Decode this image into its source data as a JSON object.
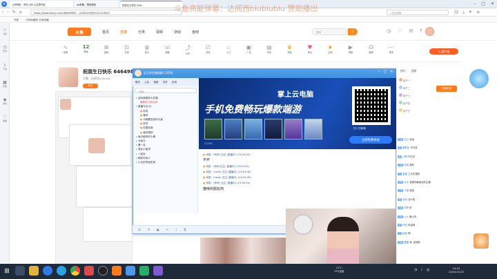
{
  "browser": {
    "tabs": [
      {
        "label": "上网导航 - 有你上网 从这里开始",
        "active": false
      },
      {
        "label": "qq邮箱 - 搜狗搜索",
        "active": false
      },
      {
        "label": "祝我生日快乐 646...",
        "active": true
      }
    ],
    "address": "https://www.douyu.com/6464986?  ...202002/0@2021123022",
    "banner_text": "斗鱼高能弹幕：达闻西biubiubiu 赞助播出",
    "search_placeholder": "在此搜索",
    "bookmarks": [
      "书签",
      "已有收藏夹 已有收藏"
    ],
    "side_tools": [
      "书签",
      "历史",
      "下载",
      "应用",
      "游戏",
      "收藏"
    ]
  },
  "site": {
    "logo": "斗鱼",
    "nav": [
      "首页",
      "直播",
      "分类",
      "视频",
      "游戏",
      "鱼吧"
    ],
    "active_nav": "直播",
    "search_placeholder": "搜索",
    "toolbar": [
      {
        "label": "音量",
        "icon": "wave-icon"
      },
      {
        "label": "等级",
        "value": "12"
      },
      {
        "label": "福利",
        "icon": "gift-icon"
      },
      {
        "label": "礼物",
        "icon": "gift-icon"
      },
      {
        "label": "鱼丸",
        "icon": "fish-icon"
      },
      {
        "label": "弹幕",
        "icon": "chat-icon"
      },
      {
        "label": "分享",
        "icon": "share-icon"
      },
      {
        "label": "任务",
        "icon": "task-icon"
      },
      {
        "label": "火力",
        "icon": "fire-icon"
      },
      {
        "label": "广告",
        "icon": "ad-icon"
      },
      {
        "label": "背包",
        "icon": "bag-icon"
      },
      {
        "label": "贵族",
        "icon": "crown-icon"
      },
      {
        "label": "粉丝",
        "icon": "heart-icon"
      },
      {
        "label": "活动",
        "icon": "star-icon"
      },
      {
        "label": "视频",
        "icon": "video-icon"
      },
      {
        "label": "客服",
        "icon": "service-icon"
      },
      {
        "label": "更多",
        "icon": "more-icon"
      }
    ],
    "pc_client": "PC客户端"
  },
  "room": {
    "title": "祝我生日快乐 6464986",
    "subtitle": "主播：达闻西biubiubiu",
    "follow": "关注"
  },
  "qq": {
    "title": "云大学生服务群 (1456)",
    "tabs": [
      "聊天",
      "公告",
      "相册",
      "文件",
      "应用"
    ],
    "search_placeholder": "搜索",
    "groups": [
      "会有美丽的大花猫",
      "最新的人别出声",
      "直播今天(4)",
      "你说",
      "雪你",
      "今晚要变成你大鱼",
      "好好",
      "你喜欢我",
      "我好想的",
      "每天都有好心情",
      "大秋天",
      "第一名",
      "美女小姐来",
      "一起玩",
      "精彩时间人",
      "小白的早起发现"
    ],
    "ad": {
      "line1": "掌上云电脑",
      "line2": "手机免费畅玩爆款端游",
      "btn": "立即免费体验",
      "qr": "扫一扫体验",
      "tag": "CLOUD"
    },
    "messages": [
      "消息：(有吗) 达达 (直播中) (19:04:44)",
      "不开",
      "消息：(有吗)达达 (直播中) (19:04:45)",
      "消息：(hello) 达达 (直播中) (19:04:46)",
      "消息：(hello) 达达 (直播中) (19:04:49)",
      "消息：(有吗) 达达 (直播中) (19:04:54)",
      "猫咪的朋友阿"
    ],
    "send": "发送",
    "close": "关闭"
  },
  "chat_panel": {
    "tabs": [
      "排行",
      "贡献"
    ],
    "vip": "开通贵族",
    "rank": [
      "用户一",
      "用户二",
      "用户三",
      "用户四",
      "用户五"
    ],
    "items": [
      {
        "name": "红心",
        "msg": "加油"
      },
      {
        "name": "跟着走",
        "msg": "不打扰"
      },
      {
        "name": "刀锋",
        "msg": "不打字"
      },
      {
        "name": "哈哈",
        "msg": "很好"
      },
      {
        "name": "星星",
        "msg": "三大天领呢"
      },
      {
        "name": "大大",
        "msg": "我是你最喜欢的主播"
      },
      {
        "name": "小猫",
        "msg": "哈哈"
      },
      {
        "name": "呆呆",
        "msg": "怎么啦"
      },
      {
        "name": "好吧",
        "msg": "好"
      },
      {
        "name": "火火",
        "msg": "晚上好"
      },
      {
        "name": "吃吃",
        "msg": "说话呀"
      },
      {
        "name": "饭饭",
        "msg": "啊"
      },
      {
        "name": "酷酷",
        "msg": "我, 真想你"
      }
    ]
  },
  "taskbar": {
    "temp": "32°C",
    "weather": "CPU温度",
    "time": "19:01",
    "date": "2020/11/23",
    "lang": "中"
  }
}
